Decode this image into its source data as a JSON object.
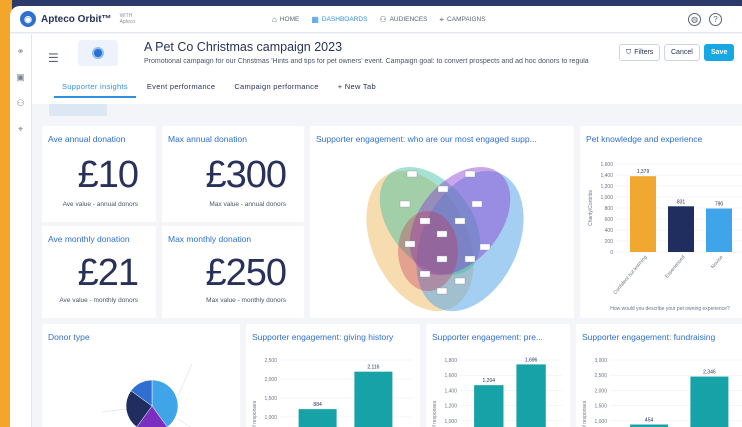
{
  "app": {
    "name": "Apteco Orbit™",
    "sub_prefix": "WITH",
    "sub_name": "Apteco"
  },
  "nav": {
    "items": [
      {
        "label": "HOME",
        "icon": "home-icon"
      },
      {
        "label": "DASHBOARDS",
        "icon": "dashboard-icon",
        "active": true
      },
      {
        "label": "AUDIENCES",
        "icon": "audiences-icon"
      },
      {
        "label": "CAMPAIGNS",
        "icon": "campaigns-icon"
      }
    ]
  },
  "topright": {
    "globe_icon": "globe-icon",
    "help_icon": "help-icon",
    "help_glyph": "?"
  },
  "dashboard": {
    "title": "A Pet Co Christmas campaign 2023",
    "description": "Promotional campaign for our Christmas 'Hints and tips for pet owners' event. Campaign goal: to convert prospects and ad hoc donors to regula",
    "filters_label": "Filters",
    "cancel_label": "Cancel",
    "save_label": "Save"
  },
  "tabs": [
    {
      "label": "Supporter insights",
      "active": true
    },
    {
      "label": "Event performance"
    },
    {
      "label": "Campaign performance"
    },
    {
      "label": "+ New Tab"
    }
  ],
  "kpis": {
    "ave_annual": {
      "title": "Ave annual donation",
      "value": "£10",
      "caption": "Ave value - annual donors"
    },
    "max_annual": {
      "title": "Max annual donation",
      "value": "£300",
      "caption": "Max value - annual donors"
    },
    "ave_monthly": {
      "title": "Ave monthly donation",
      "value": "£21",
      "caption": "Ave value - monthly donors"
    },
    "max_monthly": {
      "title": "Max monthly donation",
      "value": "£250",
      "caption": "Max value - monthly donors"
    }
  },
  "tiles": {
    "venn_title": "Supporter engagement: who are our most engaged supp...",
    "pet_title": "Pet knowledge and experience",
    "donor_type_title": "Donor type",
    "giving_title": "Supporter engagement: giving history",
    "pre_title": "Supporter engagement: pre...",
    "fundraising_title": "Supporter engagement: fundraising"
  },
  "colors": {
    "accent": "#2f8fe0",
    "save": "#17a8e3",
    "orange": "#f0a830",
    "navy": "#1f2e5e",
    "lightblue": "#3fa4e8",
    "teal": "#17a2a8"
  },
  "chart_data": [
    {
      "type": "bar",
      "title": "Pet knowledge and experience",
      "xlabel": "How would you describe your pet owning experience?",
      "ylabel": "Charity/Contribs",
      "categories": [
        "Confident but learning",
        "Experienced",
        "Novice"
      ],
      "values": [
        1379,
        831,
        790
      ],
      "value_labels": [
        "1,379",
        "831",
        "790"
      ],
      "colors": [
        "#f0a830",
        "#1f2e5e",
        "#3fa4e8"
      ],
      "ylim": [
        0,
        1600
      ],
      "yticks": [
        "1,600",
        "1,400",
        "1,200",
        "1,000",
        "800",
        "600",
        "400",
        "200",
        "0"
      ]
    },
    {
      "type": "bar",
      "title": "Supporter engagement: giving history",
      "ylabel": "No of responses",
      "values": [
        884,
        2116
      ],
      "value_labels": [
        "884",
        "2,116"
      ],
      "ylim": [
        0,
        2500
      ],
      "yticks": [
        "2,500",
        "2,000",
        "1,500",
        "1,000"
      ]
    },
    {
      "type": "bar",
      "title": "Supporter engagement: pre...",
      "ylabel": "No of responses",
      "values": [
        1204,
        1696
      ],
      "value_labels": [
        "1,204",
        "1,696"
      ],
      "ylim": [
        0,
        1800
      ],
      "yticks": [
        "1,800",
        "1,600",
        "1,400",
        "1,200",
        "1,000"
      ]
    },
    {
      "type": "bar",
      "title": "Supporter engagement: fundraising",
      "ylabel": "No of responses",
      "values": [
        454,
        2346
      ],
      "value_labels": [
        "454",
        "2,346"
      ],
      "ylim": [
        0,
        3000
      ],
      "yticks": [
        "3,000",
        "2,500",
        "2,000",
        "1,500",
        "1,000"
      ]
    },
    {
      "type": "pie",
      "title": "Donor type",
      "values": [
        40,
        20,
        25,
        15
      ],
      "colors": [
        "#3fa4e8",
        "#7a2fc0",
        "#1f2e5e",
        "#2f6fd1"
      ]
    }
  ]
}
